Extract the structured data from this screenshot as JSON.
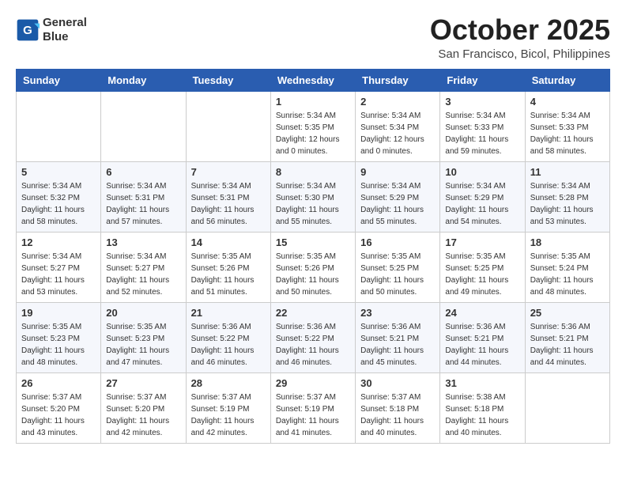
{
  "logo": {
    "line1": "General",
    "line2": "Blue"
  },
  "title": "October 2025",
  "location": "San Francisco, Bicol, Philippines",
  "days_of_week": [
    "Sunday",
    "Monday",
    "Tuesday",
    "Wednesday",
    "Thursday",
    "Friday",
    "Saturday"
  ],
  "weeks": [
    [
      {
        "day": "",
        "info": ""
      },
      {
        "day": "",
        "info": ""
      },
      {
        "day": "",
        "info": ""
      },
      {
        "day": "1",
        "info": "Sunrise: 5:34 AM\nSunset: 5:35 PM\nDaylight: 12 hours\nand 0 minutes."
      },
      {
        "day": "2",
        "info": "Sunrise: 5:34 AM\nSunset: 5:34 PM\nDaylight: 12 hours\nand 0 minutes."
      },
      {
        "day": "3",
        "info": "Sunrise: 5:34 AM\nSunset: 5:33 PM\nDaylight: 11 hours\nand 59 minutes."
      },
      {
        "day": "4",
        "info": "Sunrise: 5:34 AM\nSunset: 5:33 PM\nDaylight: 11 hours\nand 58 minutes."
      }
    ],
    [
      {
        "day": "5",
        "info": "Sunrise: 5:34 AM\nSunset: 5:32 PM\nDaylight: 11 hours\nand 58 minutes."
      },
      {
        "day": "6",
        "info": "Sunrise: 5:34 AM\nSunset: 5:31 PM\nDaylight: 11 hours\nand 57 minutes."
      },
      {
        "day": "7",
        "info": "Sunrise: 5:34 AM\nSunset: 5:31 PM\nDaylight: 11 hours\nand 56 minutes."
      },
      {
        "day": "8",
        "info": "Sunrise: 5:34 AM\nSunset: 5:30 PM\nDaylight: 11 hours\nand 55 minutes."
      },
      {
        "day": "9",
        "info": "Sunrise: 5:34 AM\nSunset: 5:29 PM\nDaylight: 11 hours\nand 55 minutes."
      },
      {
        "day": "10",
        "info": "Sunrise: 5:34 AM\nSunset: 5:29 PM\nDaylight: 11 hours\nand 54 minutes."
      },
      {
        "day": "11",
        "info": "Sunrise: 5:34 AM\nSunset: 5:28 PM\nDaylight: 11 hours\nand 53 minutes."
      }
    ],
    [
      {
        "day": "12",
        "info": "Sunrise: 5:34 AM\nSunset: 5:27 PM\nDaylight: 11 hours\nand 53 minutes."
      },
      {
        "day": "13",
        "info": "Sunrise: 5:34 AM\nSunset: 5:27 PM\nDaylight: 11 hours\nand 52 minutes."
      },
      {
        "day": "14",
        "info": "Sunrise: 5:35 AM\nSunset: 5:26 PM\nDaylight: 11 hours\nand 51 minutes."
      },
      {
        "day": "15",
        "info": "Sunrise: 5:35 AM\nSunset: 5:26 PM\nDaylight: 11 hours\nand 50 minutes."
      },
      {
        "day": "16",
        "info": "Sunrise: 5:35 AM\nSunset: 5:25 PM\nDaylight: 11 hours\nand 50 minutes."
      },
      {
        "day": "17",
        "info": "Sunrise: 5:35 AM\nSunset: 5:25 PM\nDaylight: 11 hours\nand 49 minutes."
      },
      {
        "day": "18",
        "info": "Sunrise: 5:35 AM\nSunset: 5:24 PM\nDaylight: 11 hours\nand 48 minutes."
      }
    ],
    [
      {
        "day": "19",
        "info": "Sunrise: 5:35 AM\nSunset: 5:23 PM\nDaylight: 11 hours\nand 48 minutes."
      },
      {
        "day": "20",
        "info": "Sunrise: 5:35 AM\nSunset: 5:23 PM\nDaylight: 11 hours\nand 47 minutes."
      },
      {
        "day": "21",
        "info": "Sunrise: 5:36 AM\nSunset: 5:22 PM\nDaylight: 11 hours\nand 46 minutes."
      },
      {
        "day": "22",
        "info": "Sunrise: 5:36 AM\nSunset: 5:22 PM\nDaylight: 11 hours\nand 46 minutes."
      },
      {
        "day": "23",
        "info": "Sunrise: 5:36 AM\nSunset: 5:21 PM\nDaylight: 11 hours\nand 45 minutes."
      },
      {
        "day": "24",
        "info": "Sunrise: 5:36 AM\nSunset: 5:21 PM\nDaylight: 11 hours\nand 44 minutes."
      },
      {
        "day": "25",
        "info": "Sunrise: 5:36 AM\nSunset: 5:21 PM\nDaylight: 11 hours\nand 44 minutes."
      }
    ],
    [
      {
        "day": "26",
        "info": "Sunrise: 5:37 AM\nSunset: 5:20 PM\nDaylight: 11 hours\nand 43 minutes."
      },
      {
        "day": "27",
        "info": "Sunrise: 5:37 AM\nSunset: 5:20 PM\nDaylight: 11 hours\nand 42 minutes."
      },
      {
        "day": "28",
        "info": "Sunrise: 5:37 AM\nSunset: 5:19 PM\nDaylight: 11 hours\nand 42 minutes."
      },
      {
        "day": "29",
        "info": "Sunrise: 5:37 AM\nSunset: 5:19 PM\nDaylight: 11 hours\nand 41 minutes."
      },
      {
        "day": "30",
        "info": "Sunrise: 5:37 AM\nSunset: 5:18 PM\nDaylight: 11 hours\nand 40 minutes."
      },
      {
        "day": "31",
        "info": "Sunrise: 5:38 AM\nSunset: 5:18 PM\nDaylight: 11 hours\nand 40 minutes."
      },
      {
        "day": "",
        "info": ""
      }
    ]
  ]
}
